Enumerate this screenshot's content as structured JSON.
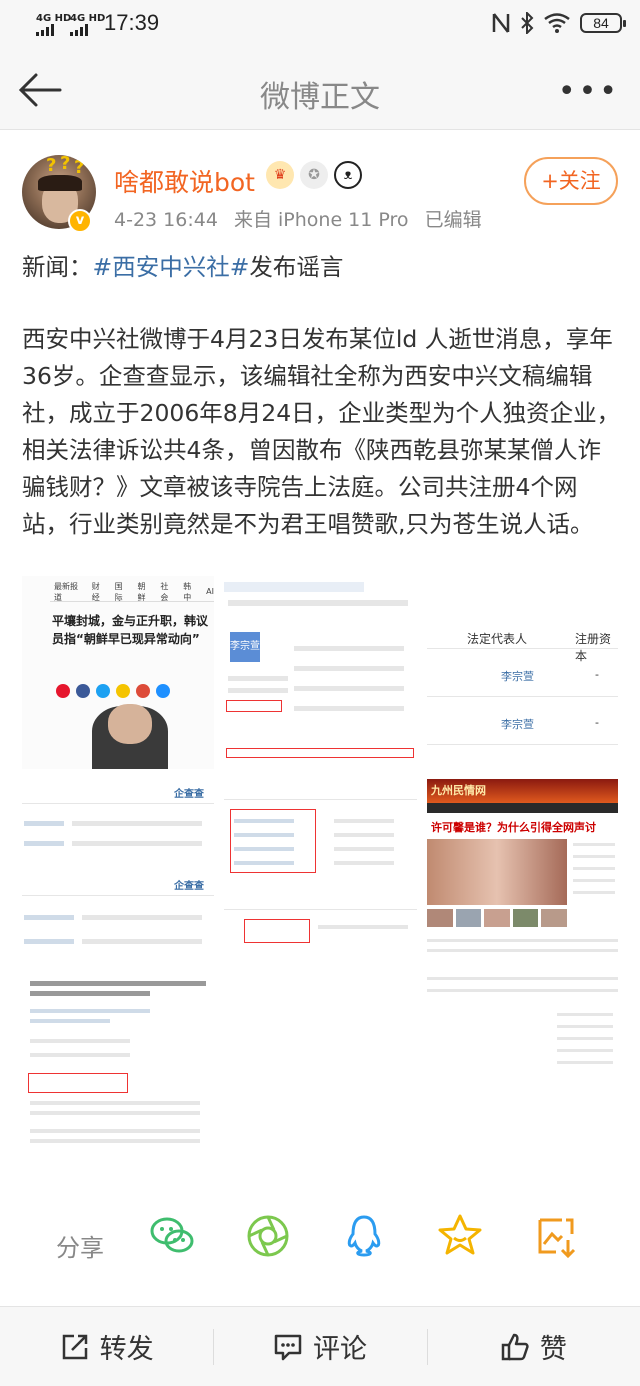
{
  "status_bar": {
    "signal1": "4G HD",
    "signal2": "4G HD",
    "time": "17:39",
    "battery": "84"
  },
  "nav": {
    "title": "微博正文"
  },
  "post": {
    "username": "啥都敢说bot",
    "timestamp": "4-23 16:44",
    "source": "来自 iPhone 11 Pro",
    "edited": "已编辑",
    "follow_label": "+关注",
    "line1_prefix": "新闻：",
    "line1_topic": "#西安中兴社#",
    "line1_suffix": "发布谣言",
    "body": "西安中兴社微博于4月23日发布某位ld 人逝世消息，享年36岁。企查查显示，该编辑社全称为西安中兴文稿编辑社，成立于2006年8月24日，企业类型为个人独资企业，相关法律诉讼共4条，曾因散布《陕西乾县弥某某僧人诈骗钱财？》文章被该寺院告上法庭。公司共注册4个网站，行业类别竟然是不为君王唱赞歌,只为苍生说人话。"
  },
  "images": {
    "img1_tabs": [
      "最新报道",
      "财经",
      "国际",
      "朝鲜",
      "社会",
      "韩中",
      "AI"
    ],
    "img1_headline": "平壤封城，金与正升职，韩议员指“朝鲜早已现异常动向”",
    "img2_label": "法定代表人",
    "img2_label2": "注册资本",
    "img2_person": "李宗萱",
    "img2_dash": "-",
    "img4_logo": "企查查",
    "img7_banner": "许可馨是谁？为什么引得全网声讨",
    "img7_site": "九州民情网"
  },
  "share": {
    "label": "分享"
  },
  "actions": {
    "repost": "转发",
    "comment": "评论",
    "like": "赞"
  },
  "colors": {
    "username": "#f26522",
    "topic": "#3b6ea5",
    "follow_border": "#f5a15a",
    "wechat": "#3fbd6e",
    "moments": "#7cc84e",
    "qq": "#2b9cf0",
    "favorite": "#f4b400",
    "save": "#f09a1e"
  }
}
